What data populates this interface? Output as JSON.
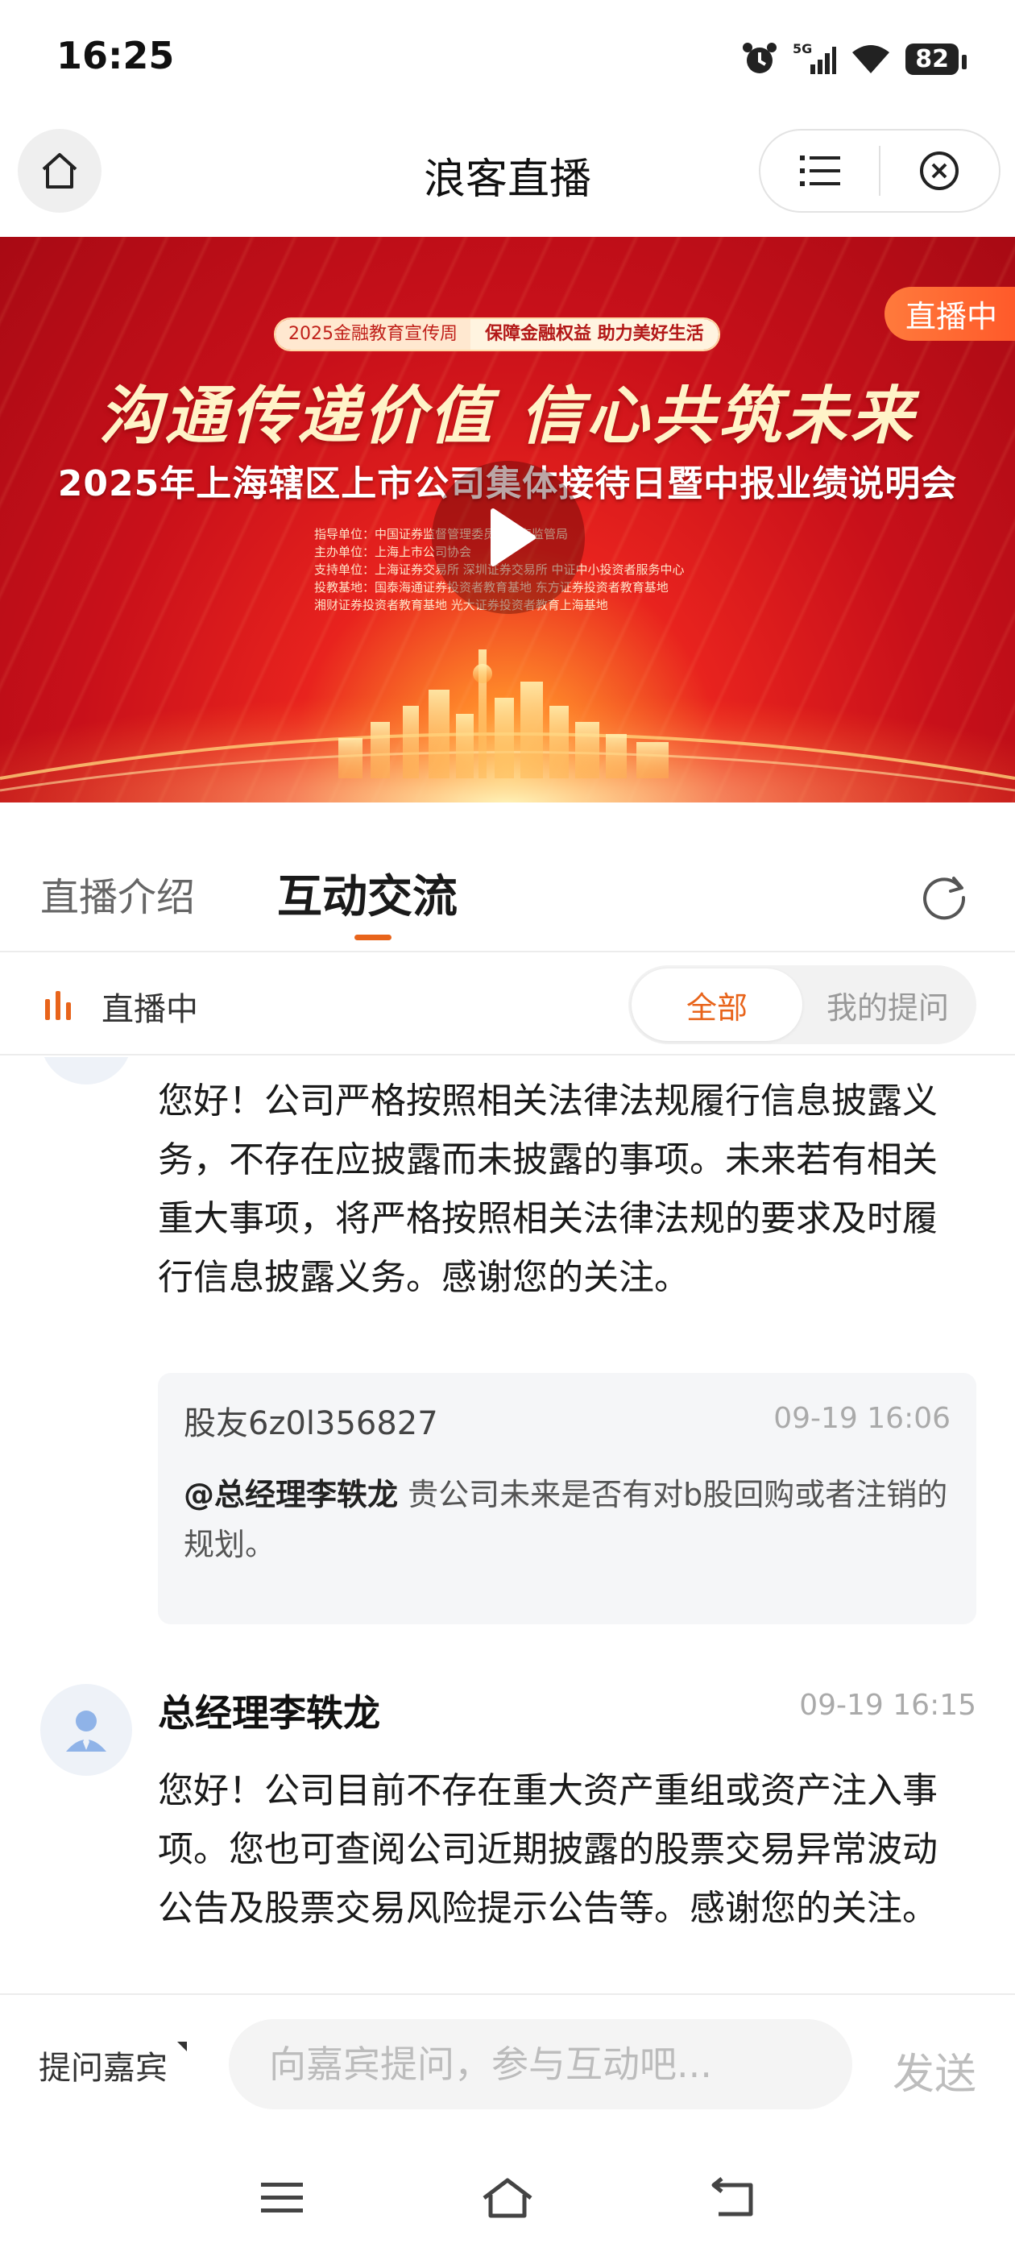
{
  "status_bar": {
    "time": "16:25",
    "battery": "82",
    "network": "5G"
  },
  "header": {
    "title": "浪客直播"
  },
  "banner": {
    "live_badge": "直播中",
    "tag_week": "2025金融教育宣传周",
    "tag_slogan": "保障金融权益 助力美好生活",
    "slogan": "沟通传递价值 信心共筑未来",
    "headline": "2025年上海辖区上市公司集体接待日暨中报业绩说明会",
    "orgs": [
      "指导单位：中国证券监督管理委员会上海监管局",
      "主办单位：上海上市公司协会",
      "支持单位：上海证券交易所  深圳证券交易所  中证中小投资者服务中心",
      "投教基地：国泰海通证券投资者教育基地  东方证券投资者教育基地",
      "湘财证券投资者教育基地  光大证券投资者教育上海基地"
    ]
  },
  "tabs": {
    "intro": "直播介绍",
    "interact": "互动交流"
  },
  "filter": {
    "live_label": "直播中",
    "all": "全部",
    "mine": "我的提问"
  },
  "feed": {
    "prev_answer": "您好！公司严格按照相关法律法规履行信息披露义务，不存在应披露而未披露的事项。未来若有相关重大事项，将严格按照相关法律法规的要求及时履行信息披露义务。感谢您的关注。",
    "quote": {
      "user": "股友6z0l356827",
      "time": "09-19 16:06",
      "mention": "@总经理李轶龙",
      "question": "贵公司未来是否有对b股回购或者注销的规划。"
    },
    "post": {
      "author": "总经理李轶龙",
      "time": "09-19 16:15",
      "answer": "您好！公司目前不存在重大资产重组或资产注入事项。您也可查阅公司近期披露的股票交易异常波动公告及股票交易风险提示公告等。感谢您的关注。"
    }
  },
  "input_bar": {
    "ask_guest": "提问嘉宾",
    "placeholder": "向嘉宾提问，参与互动吧...",
    "send": "发送"
  },
  "colors": {
    "accent": "#e8641b",
    "banner_red": "#d8141c",
    "badge": "#ff6a32"
  }
}
